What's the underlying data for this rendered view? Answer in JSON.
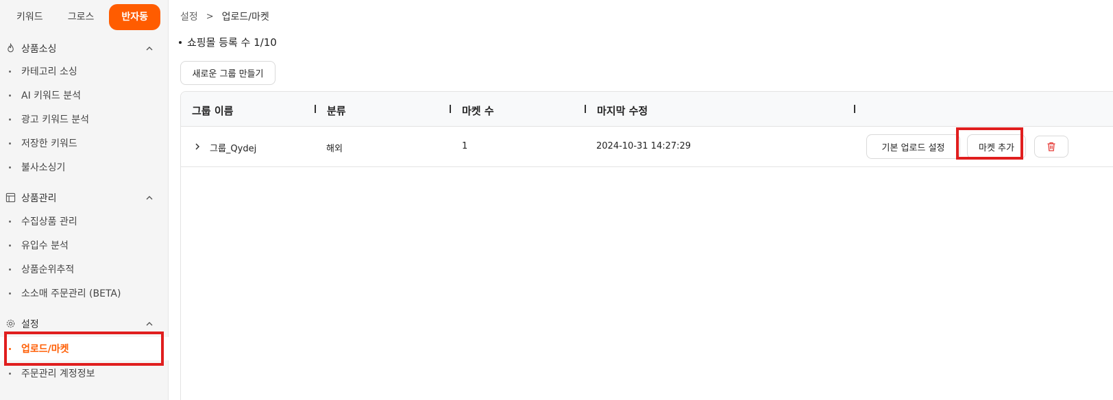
{
  "sidebar": {
    "mode_tabs": [
      "키워드",
      "그로스",
      "반자동"
    ],
    "sections": [
      {
        "label": "상품소싱",
        "items": [
          "카테고리 소싱",
          "AI 키워드 분석",
          "광고 키워드 분석",
          "저장한 키워드",
          "불사소싱기"
        ]
      },
      {
        "label": "상품관리",
        "items": [
          "수집상품 관리",
          "유입수 분석",
          "상품순위추적",
          "소소매 주문관리 (BETA)"
        ]
      },
      {
        "label": "설정",
        "items": [
          "업로드/마켓",
          "주문관리 계정정보"
        ]
      }
    ]
  },
  "breadcrumb": {
    "root": "설정",
    "separator": ">",
    "current": "업로드/마켓"
  },
  "mall_count": "쇼핑몰 등록 수 1/10",
  "new_group_button": "새로운 그룹 만들기",
  "table": {
    "headers": [
      "그룹 이름",
      "분류",
      "마켓 수",
      "마지막 수정"
    ],
    "rows": [
      {
        "group_name": "그룹_Qydej",
        "category": "해외",
        "market_count": "1",
        "last_modified": "2024-10-31 14:27:29"
      }
    ],
    "actions": {
      "default_upload": "기본 업로드 설정",
      "add_market": "마켓 추가"
    }
  },
  "colors": {
    "accent": "#ff5c00",
    "highlight_box": "#e01e1e",
    "delete": "#e53935"
  }
}
